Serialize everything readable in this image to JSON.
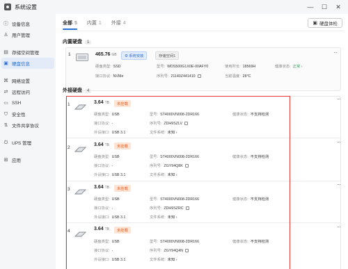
{
  "window": {
    "title": "系统设置",
    "controls": [
      "—",
      "☐",
      "✕"
    ]
  },
  "sidebar": {
    "items": [
      {
        "label": "设备信息",
        "icon": "info-icon",
        "glyph": "ⓘ"
      },
      {
        "label": "用户管理",
        "icon": "user-icon",
        "glyph": "♙"
      },
      {
        "label": "存储空间管理",
        "icon": "storage-icon",
        "glyph": "▤"
      },
      {
        "label": "硬盘信息",
        "icon": "disk-icon",
        "glyph": "▣",
        "active": true
      },
      {
        "label": "网络设置",
        "icon": "network-icon",
        "glyph": "⌘"
      },
      {
        "label": "远程访问",
        "icon": "remote-icon",
        "glyph": "⇄"
      },
      {
        "label": "SSH",
        "icon": "terminal-icon",
        "glyph": "▭"
      },
      {
        "label": "安全性",
        "icon": "shield-icon",
        "glyph": "⛉"
      },
      {
        "label": "文件共享协议",
        "icon": "share-icon",
        "glyph": "⇅"
      },
      {
        "label": "UPS 管理",
        "icon": "power-icon",
        "glyph": "⏻"
      },
      {
        "label": "应用",
        "icon": "apps-icon",
        "glyph": "⊞"
      }
    ]
  },
  "tabs": [
    {
      "label": "全部",
      "count": "5"
    },
    {
      "label": "内置",
      "count": "1"
    },
    {
      "label": "外接",
      "count": "4"
    }
  ],
  "health_button": {
    "label": "硬盘体检",
    "icon": "medkit-icon"
  },
  "internal": {
    "title": "内置硬盘",
    "count": "1",
    "disk": {
      "number": "1",
      "capacity": "465.76",
      "unit": "GB",
      "tag_system": "系统安装",
      "tag_space": "存储空间1",
      "type_label": "硬盘类型:",
      "type": "SSD",
      "model_label": "型号:",
      "model": "WDS500G1X0E-00AFY0",
      "hours_label": "使用时长:",
      "hours": "18569H",
      "health_label": "健康状态:",
      "health": "正常",
      "iface_label": "接口协议:",
      "iface": "NVMe",
      "serial_label": "序列号:",
      "serial": "21140Z441410",
      "temp_label": "当前温度:",
      "temp": "28°C"
    }
  },
  "external": {
    "title": "外接硬盘",
    "count": "4",
    "disks": [
      {
        "number": "1",
        "capacity": "3.64",
        "unit": "TB",
        "status": "未挂载",
        "type": "USB",
        "model": "ST4000VN008-2DR166",
        "health": "不支持检测",
        "iface": "-",
        "serial": "ZDH9SZLV",
        "port": "USB 3.1",
        "fs": "未知"
      },
      {
        "number": "2",
        "capacity": "3.64",
        "unit": "TB",
        "status": "未挂载",
        "type": "USB",
        "model": "ST4000VN008-2DR166",
        "health": "不支持检测",
        "iface": "-",
        "serial": "ZGY94Q8K",
        "port": "USB 3.1",
        "fs": "未知"
      },
      {
        "number": "3",
        "capacity": "3.64",
        "unit": "TB",
        "status": "未挂载",
        "type": "USB",
        "model": "ST4000VN008-2DR166",
        "health": "不支持检测",
        "iface": "-",
        "serial": "ZDH9SZRC",
        "port": "USB 3.1",
        "fs": "未知"
      },
      {
        "number": "4",
        "capacity": "3.64",
        "unit": "TB",
        "status": "未挂载",
        "type": "USB",
        "model": "ST4000VN008-2DR166",
        "health": "不支持检测",
        "iface": "-",
        "serial": "ZGY94Q4N",
        "port": "USB 3.1",
        "fs": "未知"
      }
    ],
    "labels": {
      "type": "硬盘类型:",
      "model": "型号:",
      "health": "健康状态:",
      "iface": "接口协议:",
      "serial": "序列号:",
      "port": "外设接口:",
      "fs": "文件系统:"
    }
  },
  "colors": {
    "accent": "#2a6fd6",
    "highlight_box": "#e53935",
    "unmounted": "#e2632b",
    "ok": "#23a55a"
  }
}
